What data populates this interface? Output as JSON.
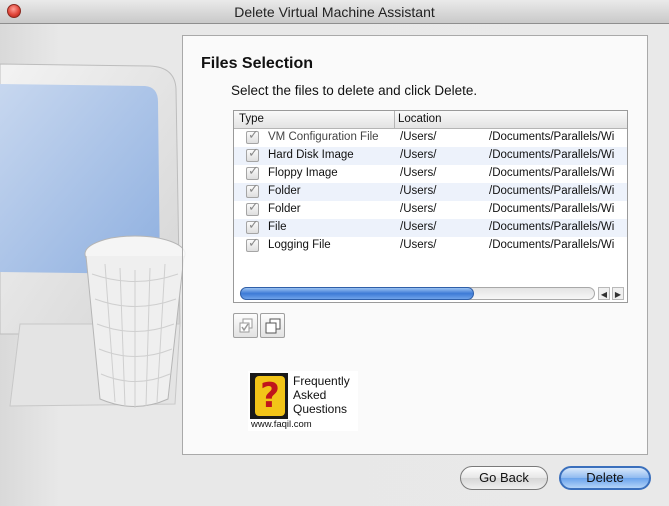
{
  "window": {
    "title": "Delete Virtual Machine Assistant"
  },
  "page": {
    "heading": "Files Selection",
    "instruction": "Select the files to delete and click Delete."
  },
  "table": {
    "columns": [
      "Type",
      "Location"
    ],
    "rows": [
      {
        "checked": true,
        "enabled": false,
        "type": "VM Configuration File",
        "location_a": "/Users/",
        "location_b": "/Documents/Parallels/Wi"
      },
      {
        "checked": true,
        "enabled": true,
        "type": "Hard Disk Image",
        "location_a": "/Users/",
        "location_b": "/Documents/Parallels/Wi"
      },
      {
        "checked": true,
        "enabled": true,
        "type": "Floppy Image",
        "location_a": "/Users/",
        "location_b": "/Documents/Parallels/Wi"
      },
      {
        "checked": true,
        "enabled": true,
        "type": "Folder",
        "location_a": "/Users/",
        "location_b": "/Documents/Parallels/Wi"
      },
      {
        "checked": true,
        "enabled": true,
        "type": "Folder",
        "location_a": "/Users/",
        "location_b": "/Documents/Parallels/Wi"
      },
      {
        "checked": true,
        "enabled": true,
        "type": "File",
        "location_a": "/Users/",
        "location_b": "/Documents/Parallels/Wi"
      },
      {
        "checked": true,
        "enabled": true,
        "type": "Logging File",
        "location_a": "/Users/",
        "location_b": "/Documents/Parallels/Wi"
      }
    ],
    "scroll_position": 0.66
  },
  "tools": [
    {
      "name": "check-all-icon"
    },
    {
      "name": "copy-icon"
    }
  ],
  "faq": {
    "mark": "?",
    "line1": "Frequently",
    "line2": "Asked",
    "line3": "Questions",
    "url": "www.faqil.com"
  },
  "buttons": {
    "back": "Go Back",
    "delete": "Delete"
  },
  "colors": {
    "accent": "#3d7ad6",
    "close": "#e0463a",
    "alt_row": "#edf2fb"
  }
}
